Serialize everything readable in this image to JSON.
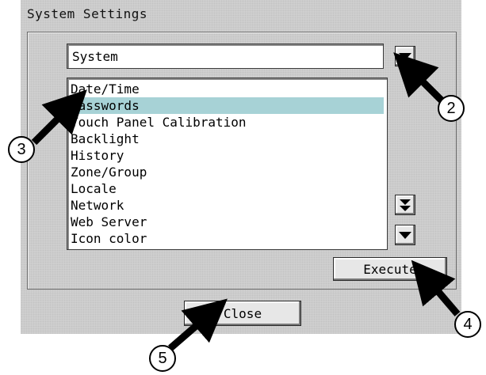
{
  "window": {
    "title": "System Settings"
  },
  "category_dropdown": {
    "value": "System"
  },
  "settings_list": {
    "items": [
      "Date/Time",
      "Passwords",
      "Touch Panel Calibration",
      "Backlight",
      "History",
      "Zone/Group",
      "Locale",
      "Network",
      "Web Server",
      "Icon color"
    ],
    "selected": "Passwords"
  },
  "buttons": {
    "execute": "Execute",
    "close": "Close"
  },
  "callouts": [
    "2",
    "3",
    "4",
    "5"
  ],
  "colors": {
    "selection": "#a7d2d6",
    "background": "#cfcfcf"
  }
}
